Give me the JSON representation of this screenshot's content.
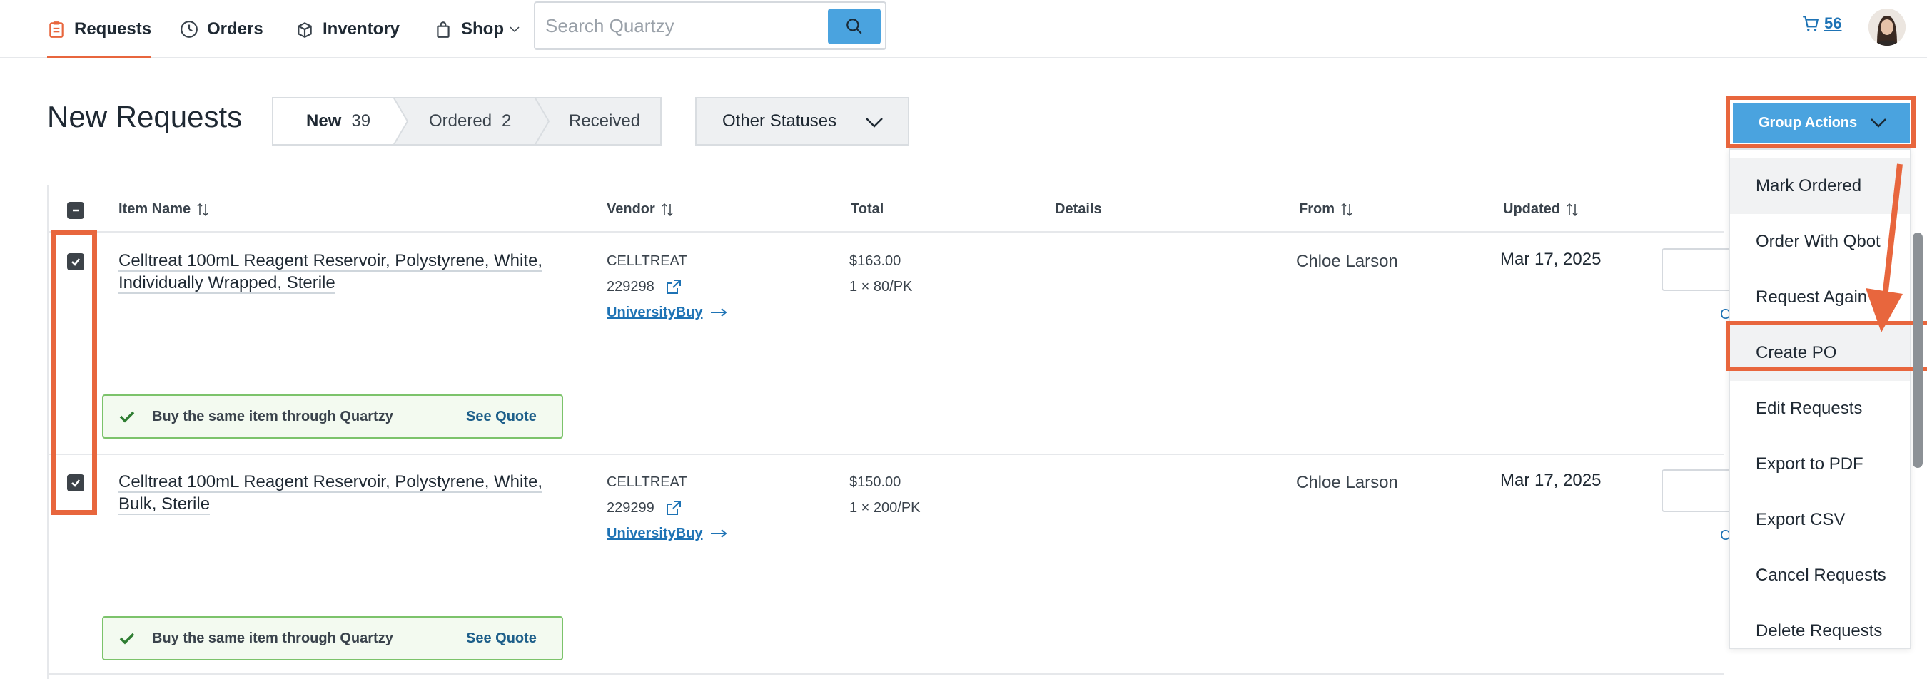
{
  "nav": {
    "items": [
      {
        "label": "Requests",
        "icon": "clipboard-icon",
        "active": true
      },
      {
        "label": "Orders",
        "icon": "clock-icon"
      },
      {
        "label": "Inventory",
        "icon": "box-icon"
      },
      {
        "label": "Shop",
        "icon": "bag-icon"
      }
    ],
    "search_placeholder": "Search Quartzy",
    "cart_count": "56"
  },
  "header": {
    "title": "New Requests",
    "tabs": [
      {
        "label": "New",
        "count": "39"
      },
      {
        "label": "Ordered",
        "count": "2"
      },
      {
        "label": "Received",
        "count": ""
      }
    ],
    "other_statuses": "Other Statuses",
    "group_actions": "Group Actions"
  },
  "table": {
    "columns": [
      "Item Name",
      "Vendor",
      "Total",
      "Details",
      "From",
      "Updated"
    ],
    "rows": [
      {
        "name": "Celltreat 100mL Reagent Reservoir, Polystyrene, White, Individually Wrapped, Sterile",
        "vendor": "CELLTREAT",
        "sku": "229298",
        "vendor_link": "UniversityBuy",
        "price": "$163.00",
        "pack": "1 × 80/PK",
        "from": "Chloe Larson",
        "updated": "Mar 17, 2025",
        "link_char": "C",
        "banner_text": "Buy the same item through Quartzy",
        "banner_link": "See Quote"
      },
      {
        "name": "Celltreat 100mL Reagent Reservoir, Polystyrene, White, Bulk, Sterile",
        "vendor": "CELLTREAT",
        "sku": "229299",
        "vendor_link": "UniversityBuy",
        "price": "$150.00",
        "pack": "1 × 200/PK",
        "from": "Chloe Larson",
        "updated": "Mar 17, 2025",
        "link_char": "C",
        "banner_text": "Buy the same item through Quartzy",
        "banner_link": "See Quote"
      }
    ]
  },
  "dropdown": {
    "items": [
      "Mark Ordered",
      "Order With Qbot",
      "Request Again",
      "Create PO",
      "Edit Requests",
      "Export to PDF",
      "Export CSV",
      "Cancel Requests",
      "Delete Requests"
    ]
  },
  "colors": {
    "accent": "#e8663d",
    "primary": "#4aa3df",
    "link": "#1e73b5",
    "success": "#7cc36b"
  }
}
